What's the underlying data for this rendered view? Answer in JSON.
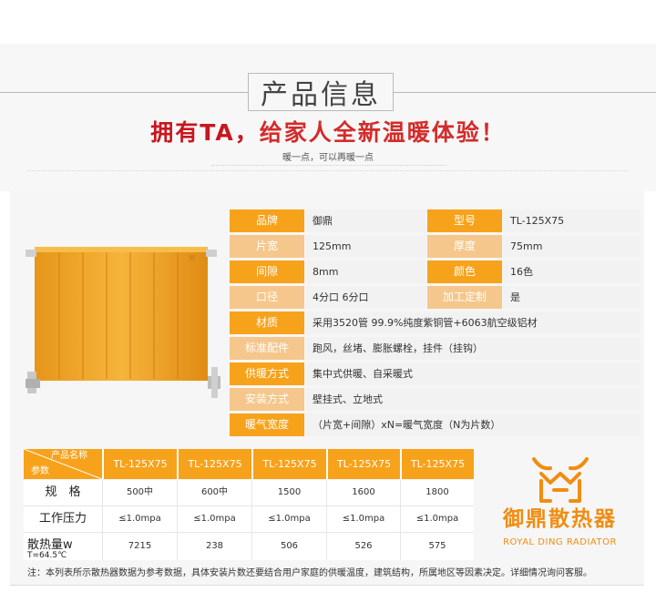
{
  "header": {
    "title": "产品信息",
    "slogan_part1": "拥有TA，",
    "slogan_part2": "给家人全新温暖体验！",
    "subslogan": "暖一点，可以再暖一点"
  },
  "specs": [
    {
      "label": "品牌",
      "value": "御鼎",
      "label2": "型号",
      "value2": "TL-125X75"
    },
    {
      "label": "片宽",
      "value": "125mm",
      "label2": "厚度",
      "value2": "75mm"
    },
    {
      "label": "间隙",
      "value": "8mm",
      "label2": "颜色",
      "value2": "16色"
    },
    {
      "label": "口径",
      "value": "4分口 6分口",
      "label2": "加工定制",
      "value2": "是"
    },
    {
      "label": "材质",
      "value": "采用3520管 99.9%纯度紫铜管+6063航空级铝材"
    },
    {
      "label": "标准配件",
      "value": "跑风，丝堵、膨胀螺栓，挂件（挂钩）"
    },
    {
      "label": "供暖方式",
      "value": "集中式供暖、自采暖式"
    },
    {
      "label": "安装方式",
      "value": "壁挂式、立地式"
    },
    {
      "label": "暖气宽度",
      "value": "（片宽+间隙）xN=暖气宽度（N为片数）"
    }
  ],
  "table": {
    "corner_top": "产品名称",
    "corner_bottom": "参数",
    "columns": [
      "TL-125X75",
      "TL-125X75",
      "TL-125X75",
      "TL-125X75",
      "TL-125X75"
    ],
    "rows": [
      {
        "label": "规　格",
        "values": [
          "500中",
          "600中",
          "1500",
          "1600",
          "1800"
        ]
      },
      {
        "label": "工作压力",
        "values": [
          "≤1.0mpa",
          "≤1.0mpa",
          "≤1.0mpa",
          "≤1.0mpa",
          "≤1.0mpa"
        ]
      },
      {
        "label": "散热量w",
        "sublabel": "T=64.5℃",
        "values": [
          "7215",
          "238",
          "506",
          "526",
          "575"
        ]
      }
    ]
  },
  "logo": {
    "name": "御鼎散热器",
    "english": "ROYAL DING RADIATOR"
  },
  "note": "注：本列表所示散热器数据为参考数据，具体安装片数还要结合用户家庭的供暖温度，建筑结构，所属地区等因素决定。详细情况询问客服。",
  "colors": {
    "accent": "#f7a21b",
    "accent_pale": "#f5c78c",
    "slogan_red": "#c8171e",
    "logo_orange": "#f08d12",
    "radiator_gold": "#f0a623"
  }
}
